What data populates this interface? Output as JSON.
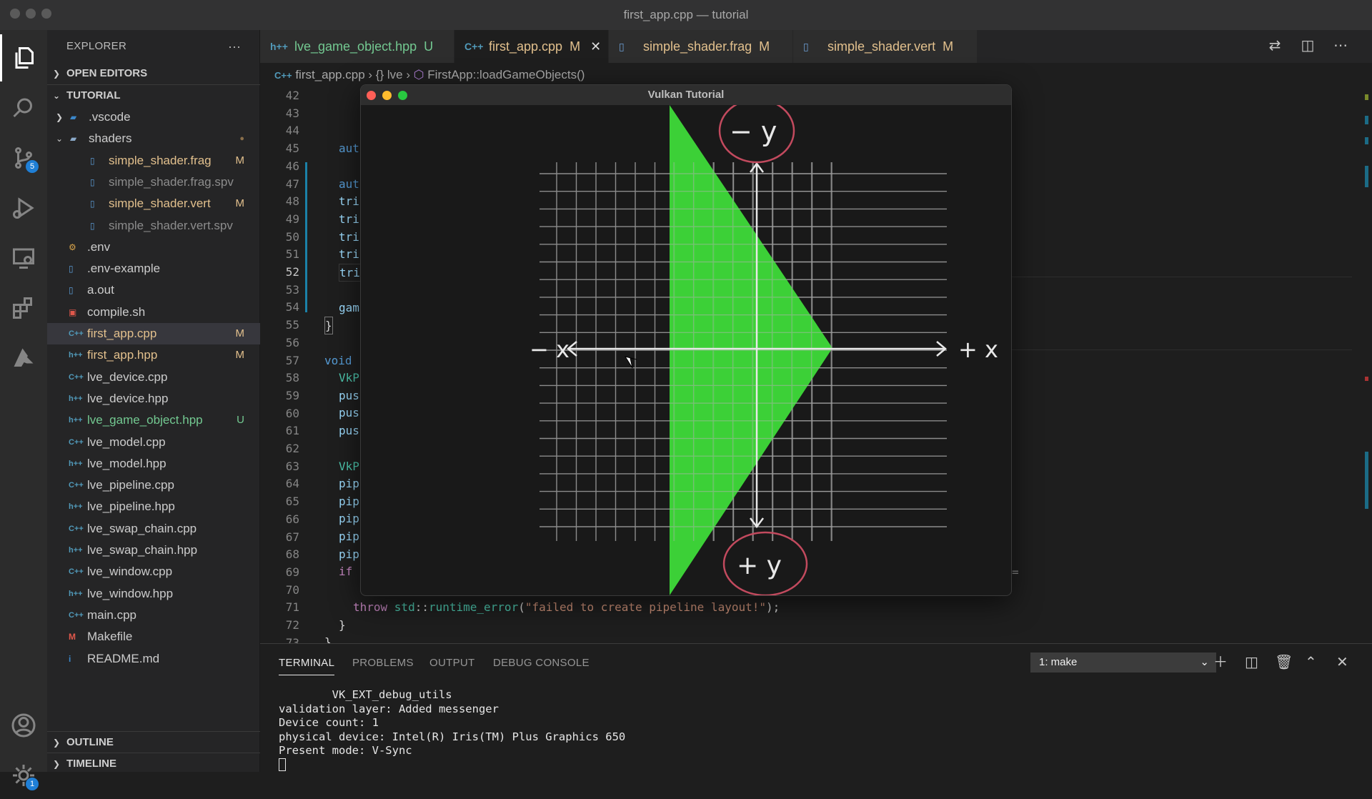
{
  "window": {
    "title": "first_app.cpp — tutorial"
  },
  "activity_bar": {
    "source_control_badge": "5",
    "settings_badge": "1"
  },
  "explorer": {
    "title": "EXPLORER",
    "more_label": "···",
    "open_editors": "OPEN EDITORS",
    "folder": "TUTORIAL",
    "outline": "OUTLINE",
    "timeline": "TIMELINE",
    "items": [
      {
        "name": ".vscode",
        "icon": "vscode-folder-icon",
        "status": ""
      },
      {
        "name": "shaders",
        "icon": "folder-icon",
        "status": "●"
      },
      {
        "name": "simple_shader.frag",
        "icon": "file-icon",
        "status": "M"
      },
      {
        "name": "simple_shader.frag.spv",
        "icon": "file-icon",
        "status": ""
      },
      {
        "name": "simple_shader.vert",
        "icon": "file-icon",
        "status": "M"
      },
      {
        "name": "simple_shader.vert.spv",
        "icon": "file-icon",
        "status": ""
      },
      {
        "name": ".env",
        "icon": "env-icon",
        "status": ""
      },
      {
        "name": ".env-example",
        "icon": "file-icon",
        "status": ""
      },
      {
        "name": "a.out",
        "icon": "file-icon",
        "status": ""
      },
      {
        "name": "compile.sh",
        "icon": "shell-icon",
        "status": ""
      },
      {
        "name": "first_app.cpp",
        "icon": "cpp-icon",
        "status": "M"
      },
      {
        "name": "first_app.hpp",
        "icon": "hpp-icon",
        "status": "M"
      },
      {
        "name": "lve_device.cpp",
        "icon": "cpp-icon",
        "status": ""
      },
      {
        "name": "lve_device.hpp",
        "icon": "hpp-icon",
        "status": ""
      },
      {
        "name": "lve_game_object.hpp",
        "icon": "hpp-icon",
        "status": "U"
      },
      {
        "name": "lve_model.cpp",
        "icon": "cpp-icon",
        "status": ""
      },
      {
        "name": "lve_model.hpp",
        "icon": "hpp-icon",
        "status": ""
      },
      {
        "name": "lve_pipeline.cpp",
        "icon": "cpp-icon",
        "status": ""
      },
      {
        "name": "lve_pipeline.hpp",
        "icon": "hpp-icon",
        "status": ""
      },
      {
        "name": "lve_swap_chain.cpp",
        "icon": "cpp-icon",
        "status": ""
      },
      {
        "name": "lve_swap_chain.hpp",
        "icon": "hpp-icon",
        "status": ""
      },
      {
        "name": "lve_window.cpp",
        "icon": "cpp-icon",
        "status": ""
      },
      {
        "name": "lve_window.hpp",
        "icon": "hpp-icon",
        "status": ""
      },
      {
        "name": "main.cpp",
        "icon": "cpp-icon",
        "status": ""
      },
      {
        "name": "Makefile",
        "icon": "makefile-icon",
        "status": ""
      },
      {
        "name": "README.md",
        "icon": "info-icon",
        "status": ""
      }
    ]
  },
  "tabs": [
    {
      "label": "lve_game_object.hpp",
      "icon": "h++",
      "status": "U"
    },
    {
      "label": "first_app.cpp",
      "icon": "C++",
      "status": "M",
      "close": "✕"
    },
    {
      "label": "simple_shader.frag",
      "icon": "file",
      "status": "M"
    },
    {
      "label": "simple_shader.vert",
      "icon": "file",
      "status": "M"
    }
  ],
  "breadcrumb": {
    "file": "first_app.cpp",
    "namespace": "{} lve",
    "symbol": "FirstApp::loadGameObjects()"
  },
  "editor": {
    "line_numbers": [
      "42",
      "43",
      "44",
      "45",
      "46",
      "47",
      "48",
      "49",
      "50",
      "51",
      "52",
      "53",
      "54",
      "55",
      "56",
      "57",
      "58",
      "59",
      "60",
      "61",
      "62",
      "63",
      "64",
      "65",
      "66",
      "67",
      "68",
      "69",
      "70",
      "71",
      "72",
      "73"
    ],
    "lines": {
      "45": "aut",
      "47": "aut",
      "48": "tri",
      "49": "tri",
      "50": "tri",
      "51": "tri",
      "52": "tri",
      "54": "gam",
      "55": "}",
      "57": "void",
      "58": "VkP",
      "59": "pus",
      "60": "pus",
      "61": "pus",
      "63": "VkP",
      "64": "pip",
      "65": "pip",
      "66": "pip",
      "67": "pip",
      "68": "pip",
      "69": "if",
      "71a": "throw ",
      "71b": "std",
      "71c": "::",
      "71d": "runtime_error",
      "71e": "(",
      "71f": "\"failed to create pipeline layout!\"",
      "71g": ");",
      "72": "}",
      "73": "}"
    },
    "overflow_mark": "="
  },
  "vulkan_window": {
    "title": "Vulkan Tutorial",
    "labels": {
      "neg_x": "− x",
      "pos_x": "+ x",
      "neg_y": "− y",
      "pos_y": "+ y"
    }
  },
  "panel": {
    "tabs": [
      "TERMINAL",
      "PROBLEMS",
      "OUTPUT",
      "DEBUG CONSOLE"
    ],
    "terminal_select": "1: make",
    "terminal_lines": [
      "        VK_EXT_debug_utils",
      "validation layer: Added messenger",
      "Device count: 1",
      "physical device: Intel(R) Iris(TM) Plus Graphics 650",
      "Present mode: V-Sync"
    ]
  },
  "colors": {
    "accent": "#1f7fd6",
    "modified": "#e2c08d",
    "untracked": "#73c991",
    "triangle": "#3fe03a",
    "circle": "#c24a5e"
  }
}
